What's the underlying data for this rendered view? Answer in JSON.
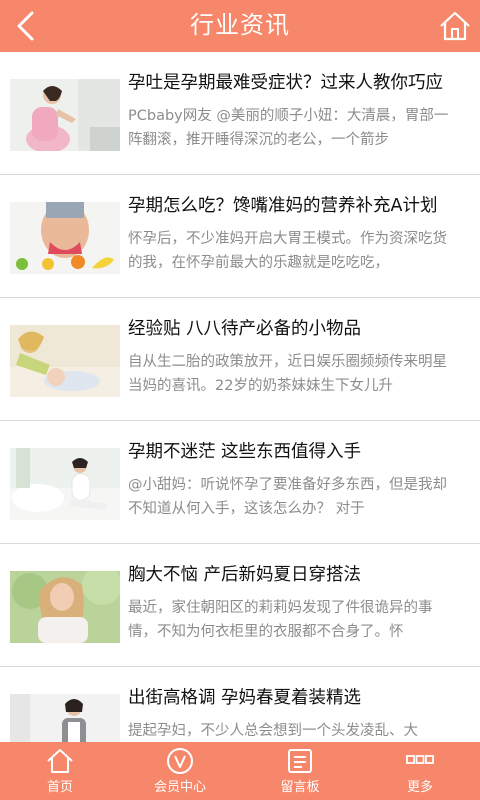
{
  "header": {
    "title": "行业资讯"
  },
  "articles": [
    {
      "title": "孕吐是孕期最难受症状？过来人教你巧应",
      "summary": "PCbaby网友 @美丽的顺子小妞：大清晨，胃部一阵翻滚，推开睡得深沉的老公，一个箭步"
    },
    {
      "title": "孕期怎么吃？馋嘴准妈的营养补充A计划",
      "summary": "怀孕后，不少准妈开启大胃王模式。作为资深吃货的我，在怀孕前最大的乐趣就是吃吃吃，"
    },
    {
      "title": "经验贴 八八待产必备的小物品",
      "summary": "自从生二胎的政策放开，近日娱乐圈频频传来明星当妈的喜讯。22岁的奶茶妹妹生下女儿升"
    },
    {
      "title": "孕期不迷茫 这些东西值得入手",
      "summary": "@小甜妈：听说怀孕了要准备好多东西，但是我却不知道从何入手，这该怎么办？      对于"
    },
    {
      "title": "胸大不恼 产后新妈夏日穿搭法",
      "summary": "最近，家住朝阳区的莉莉妈发现了件很诡异的事情，不知为何衣柜里的衣服都不合身了。怀"
    },
    {
      "title": "出街高格调 孕妈春夏着装精选",
      "summary": "提起孕妇，不少人总会想到一个头发凌乱、大"
    }
  ],
  "tabbar": {
    "items": [
      {
        "label": "首页",
        "icon": "home-icon"
      },
      {
        "label": "会员中心",
        "icon": "member-icon"
      },
      {
        "label": "留言板",
        "icon": "message-board-icon"
      },
      {
        "label": "更多",
        "icon": "more-icon"
      }
    ]
  },
  "colors": {
    "accent": "#f6876a",
    "title_text": "#111111",
    "summary_text": "#8c8c8c",
    "divider": "#d9d9d9"
  }
}
